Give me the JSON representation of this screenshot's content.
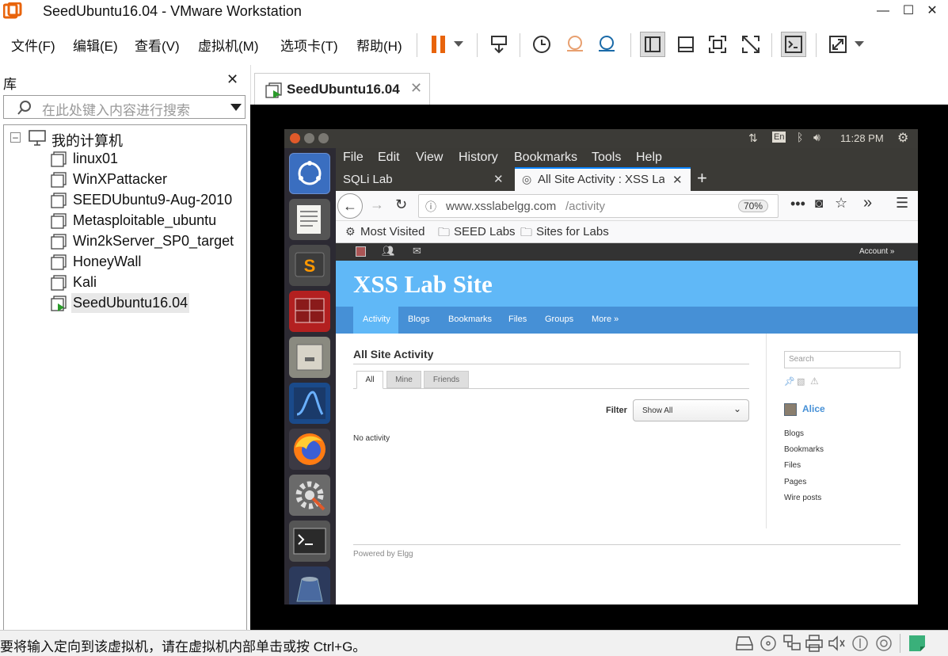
{
  "window": {
    "title": "SeedUbuntu16.04 - VMware Workstation"
  },
  "menu": [
    "文件(F)",
    "编辑(E)",
    "查看(V)",
    "虚拟机(M)",
    "选项卡(T)",
    "帮助(H)"
  ],
  "library": {
    "title": "库",
    "search_placeholder": "在此处键入内容进行搜索",
    "root": "我的计算机",
    "vms": [
      "linux01",
      "WinXPattacker",
      "SEEDUbuntu9-Aug-2010",
      "Metasploitable_ubuntu",
      "Win2kServer_SP0_target",
      "HoneyWall",
      "Kali",
      "SeedUbuntu16.04"
    ]
  },
  "vm_tab": {
    "label": "SeedUbuntu16.04"
  },
  "status": {
    "message": "要将输入定向到该虚拟机，请在虚拟机内部单击或按 Ctrl+G。"
  },
  "guest": {
    "topbar": {
      "keyboard": "En",
      "time": "11:28 PM"
    },
    "firefox": {
      "menu": [
        "File",
        "Edit",
        "View",
        "History",
        "Bookmarks",
        "Tools",
        "Help"
      ],
      "tabs": [
        "SQLi Lab",
        "All Site Activity : XSS Lab"
      ],
      "url_host": "www.xsslabelgg.com",
      "url_path": "/activity",
      "zoom": "70%",
      "bookmarks": [
        "Most Visited",
        "SEED Labs",
        "Sites for Labs"
      ]
    },
    "site": {
      "account": "Account »",
      "title": "XSS Lab Site",
      "nav": [
        "Activity",
        "Blogs",
        "Bookmarks",
        "Files",
        "Groups",
        "More »"
      ],
      "heading": "All Site Activity",
      "tabs": [
        "All",
        "Mine",
        "Friends"
      ],
      "filter_label": "Filter",
      "filter_value": "Show All",
      "empty": "No activity",
      "search_placeholder": "Search",
      "user": "Alice",
      "side_links": [
        "Blogs",
        "Bookmarks",
        "Files",
        "Pages",
        "Wire posts"
      ],
      "footer": "Powered by Elgg"
    }
  },
  "colors": {
    "accent_orange": "#e8640c",
    "elgg_header": "#60b8f7",
    "elgg_nav": "#4690d6"
  }
}
